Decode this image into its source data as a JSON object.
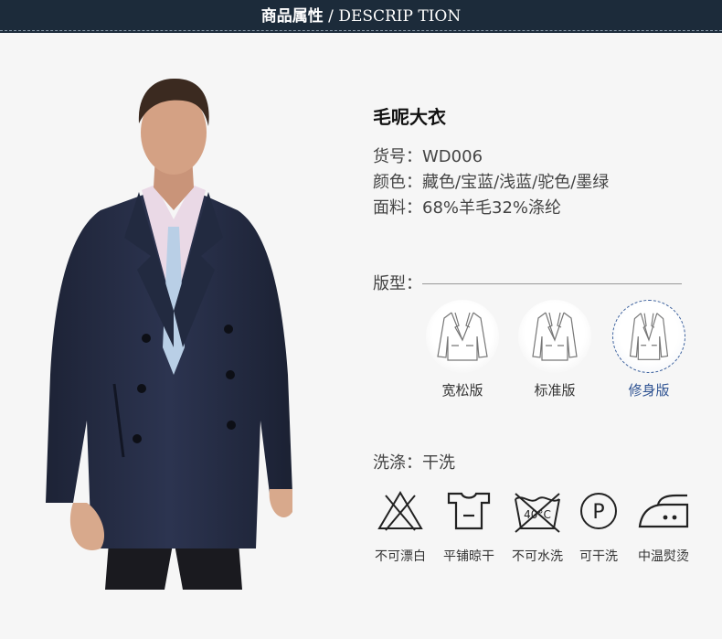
{
  "header": {
    "title_cn": "商品属性",
    "separator": " / ",
    "title_en": "DESCRIP TION"
  },
  "product": {
    "name": "毛呢大衣",
    "sku_label": "货号：",
    "sku": "WD006",
    "color_label": "颜色：",
    "colors": "藏色/宝蓝/浅蓝/驼色/墨绿",
    "fabric_label": "面料：",
    "fabric": "68%羊毛32%涤纶"
  },
  "fit": {
    "label": "版型：",
    "options": [
      {
        "name": "宽松版",
        "icon": "loose-fit-jacket-icon",
        "selected": false
      },
      {
        "name": "标准版",
        "icon": "standard-fit-jacket-icon",
        "selected": false
      },
      {
        "name": "修身版",
        "icon": "slim-fit-jacket-icon",
        "selected": true
      }
    ]
  },
  "wash": {
    "label": "洗涤：",
    "value": "干洗"
  },
  "care": [
    {
      "name": "不可漂白",
      "icon": "no-bleach-icon"
    },
    {
      "name": "平铺晾干",
      "icon": "dry-flat-icon"
    },
    {
      "name": "不可水洗",
      "icon": "no-wash-icon",
      "text": "40°C"
    },
    {
      "name": "可干洗",
      "icon": "dry-clean-icon",
      "text": "P"
    },
    {
      "name": "中温熨烫",
      "icon": "iron-medium-icon"
    }
  ],
  "colors": {
    "header_bg": "#1c2b3a",
    "selected_blue": "#2f5392",
    "coat": "#262d44"
  }
}
